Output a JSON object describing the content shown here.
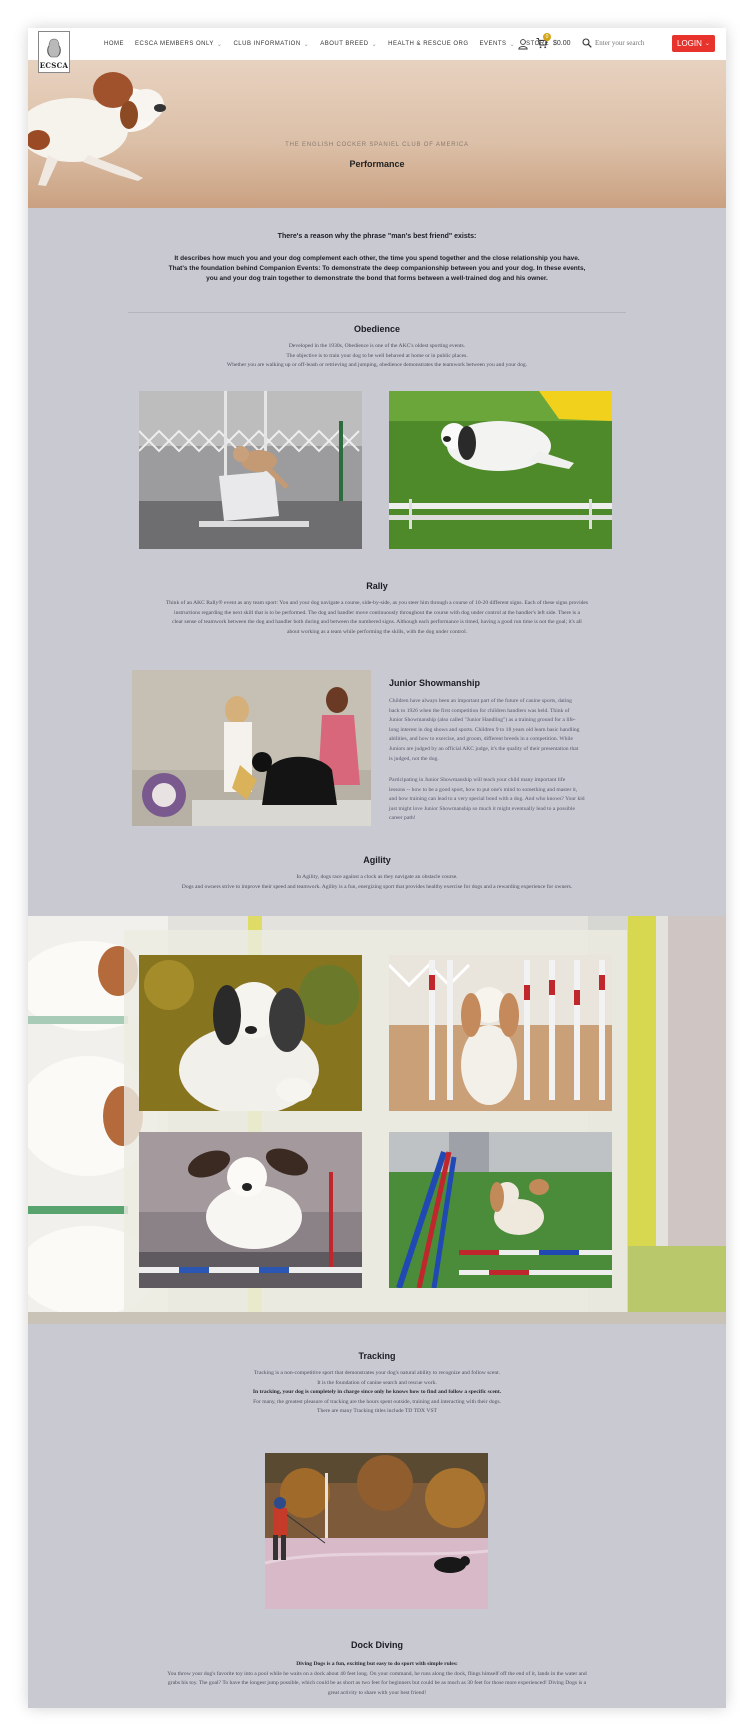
{
  "header": {
    "logo_text": "ECSCA",
    "nav": [
      {
        "label": "Home",
        "dropdown": false
      },
      {
        "label": "ECSCA Members Only",
        "dropdown": true
      },
      {
        "label": "Club Information",
        "dropdown": true
      },
      {
        "label": "About Breed",
        "dropdown": true
      },
      {
        "label": "Health & Rescue Org",
        "dropdown": false
      },
      {
        "label": "Events",
        "dropdown": true
      },
      {
        "label": "Store",
        "dropdown": false
      }
    ],
    "cart_count": "0",
    "cart_total": "$0.00",
    "search_placeholder": "Enter your search",
    "login_label": "LOGIN",
    "chevron": "⌄"
  },
  "hero": {
    "subtitle": "THE ENGLISH COCKER SPANIEL CLUB of AMERICA",
    "title": "Performance"
  },
  "intro": {
    "heading": "There's a reason why the phrase \"man's best friend\" exists:",
    "lines": [
      "It describes how much you and your dog complement each other, the time you spend together and the close relationship you have.",
      "That's the foundation behind Companion Events: To demonstrate the deep companionship between you and your dog. In these events,",
      "you and your dog train together to demonstrate the bond that forms between a well-trained dog and his owner."
    ]
  },
  "obedience": {
    "title": "Obedience",
    "lines": [
      "Developed in the 1930s, Obedience is one of the AKC's oldest sporting events.",
      "The objective is to train your dog to be well behaved at home or in public places.",
      "Whether you are walking up or off-leash or retrieving and jumping, obedience demonstrates the teamwork between you and your dog."
    ]
  },
  "rally": {
    "title": "Rally",
    "lines": [
      "Think of an AKC Rally® event as any team sport: You and your dog navigate a course, side-by-side, as you steer him through a course of 10-20 different signs. Each of these signs provides",
      "instructions regarding the next skill that is to be performed. The dog and handler move continuously throughout the course with dog under control at the handler's left side. There is a",
      "clear sense of teamwork between the dog and handler both during and between the numbered signs. Although each performance is timed, having a good run time is not the goal; it's all",
      "about working as a team while performing the skills, with the dog under control."
    ]
  },
  "junior": {
    "title": "Junior Showmanship",
    "p1": [
      "Children have always been an important part of the future of canine sports, dating",
      "back to 1926 when the first competition for children handlers was held. Think of",
      "Junior Showmanship (also called \"Junior Handling\") as a training ground for a life-",
      "long interest in dog shows and sports. Children 9 to 18 years old learn basic handling",
      "abilities, and how to exercise, and groom, different breeds in a competition. While",
      "Juniors are judged by an official AKC judge, it's the quality of their presentation that",
      "is judged, not the dog."
    ],
    "p2": [
      "Participating in Junior Showmanship will teach your child many important life",
      "lessons -- how to be a good sport, how to put one's mind to something and master it,",
      "and how training can lead to a very special bond with a dog. And who knows? Your kid",
      "just might love Junior Showmanship so much it might eventually lead to a possible",
      "career path!"
    ]
  },
  "agility": {
    "title": "Agility",
    "lines": [
      "In Agility, dogs race against a clock as they navigate an obstacle course.",
      "Dogs and owners strive to improve their speed and teamwork. Agility is a fun, energizing sport that provides healthy exercise for dogs and a rewarding experience for owners."
    ]
  },
  "tracking": {
    "title": "Tracking",
    "lines": [
      {
        "text": "Tracking is a non-competitive sport that demonstrates your dog's natural ability to recognize and follow scent.",
        "bold": false
      },
      {
        "text": "It is the foundation of canine search and rescue work.",
        "bold": false
      },
      {
        "text": "In tracking, your dog is completely in charge since only he knows how to find and follow a specific scent.",
        "bold": true
      },
      {
        "text": "For many, the greatest pleasure of tracking are the hours spent outside, training and interacting with their dogs.",
        "bold": false
      },
      {
        "text": "There are many Tracking titles include TD TDX VST",
        "bold": false
      }
    ]
  },
  "dock": {
    "title": "Dock Diving",
    "lead": "Diving Dogs is a fun, exciting but easy to do sport with simple rules:",
    "lines": [
      "You throw your dog's favorite toy into a pool while he waits on a dock about 40 feet long. On your command, he runs along the dock, flings himself off the end of it, lands in the water and",
      "grabs his toy. The goal? To have the longest jump possible, which could be as short as two feet for beginners but could be as much as 30 feet for those more experienced! Diving Dogs is a",
      "great activity to share with your best friend!"
    ]
  },
  "colors": {
    "page_bg": "#c9c9d2",
    "login": "#e8322c",
    "cart_badge": "#d4a418"
  }
}
